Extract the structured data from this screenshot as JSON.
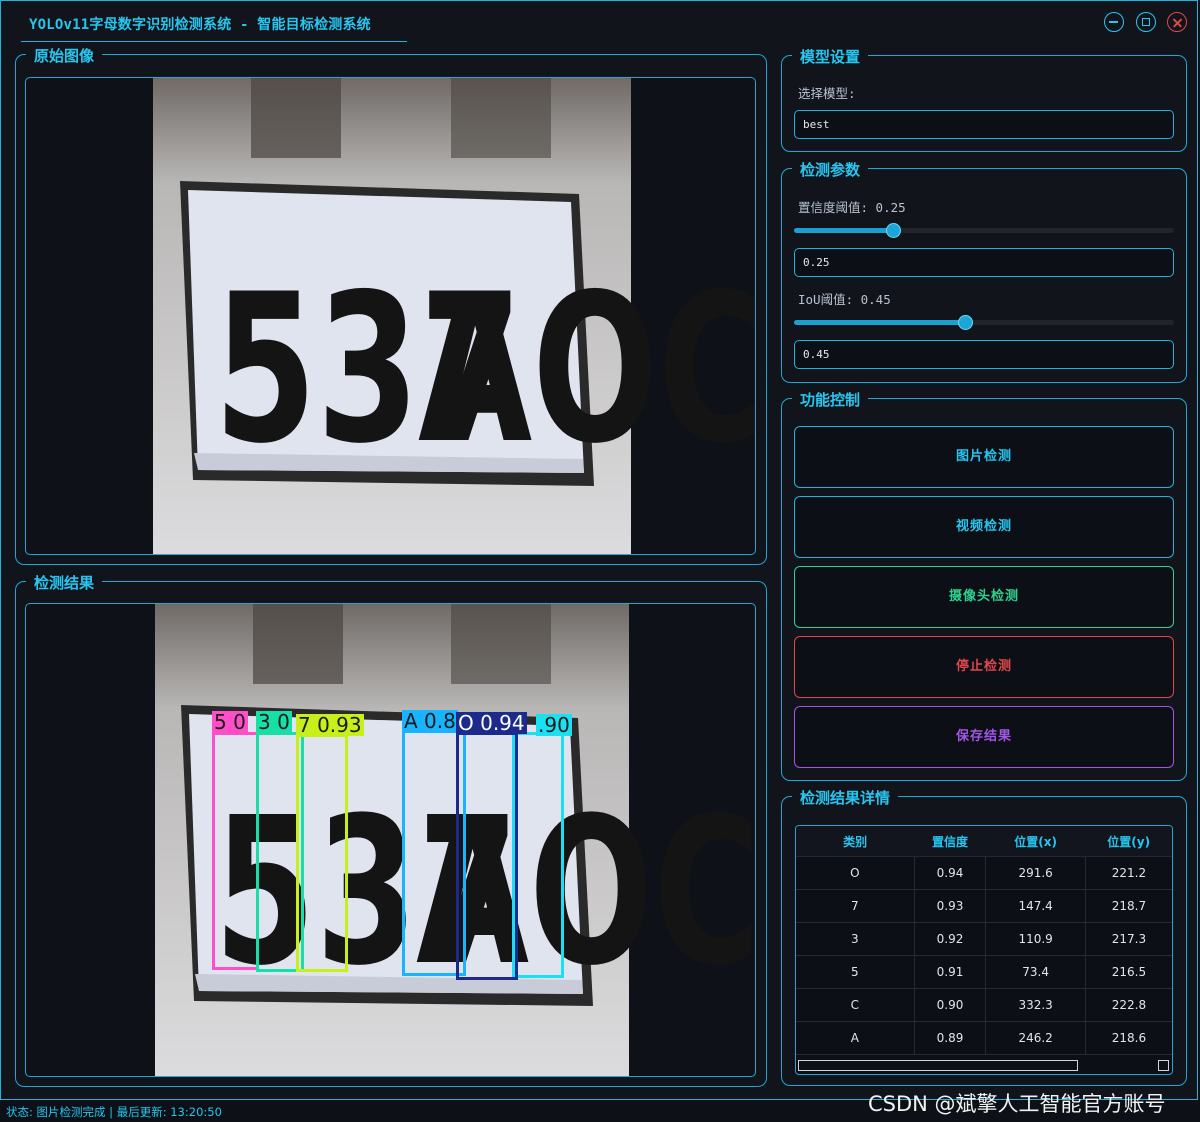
{
  "window": {
    "title": "YOLOv11字母数字识别检测系统 - 智能目标检测系统"
  },
  "panels": {
    "original_title": "原始图像",
    "result_title": "检测结果",
    "model_title": "模型设置",
    "params_title": "检测参数",
    "control_title": "功能控制",
    "details_title": "检测结果详情"
  },
  "plate": {
    "text_left": "537",
    "text_right": "AOC"
  },
  "model": {
    "select_label": "选择模型:",
    "selected": "best"
  },
  "params": {
    "conf_label": "置信度阈值: 0.25",
    "conf_value": "0.25",
    "conf_level": 0.26,
    "iou_label": "IoU阈值: 0.45",
    "iou_value": "0.45",
    "iou_level": 0.45
  },
  "controls": {
    "image_detect": "图片检测",
    "video_detect": "视频检测",
    "camera_detect": "摄像头检测",
    "stop_detect": "停止检测",
    "save_result": "保存结果"
  },
  "detections": [
    {
      "label": "5 0",
      "color": "#ff4fc8"
    },
    {
      "label": "3 0",
      "color": "#16e0a8"
    },
    {
      "label": "7 0.93",
      "color": "#c8ef1a"
    },
    {
      "label": "A 0.8",
      "color": "#18b4ff"
    },
    {
      "label": "O 0.94",
      "color": "#1c2a8c"
    },
    {
      "label": ".90",
      "color": "#1ae0f2"
    }
  ],
  "table": {
    "headers": [
      "类别",
      "置信度",
      "位置(x)",
      "位置(y)"
    ],
    "rows": [
      [
        "O",
        "0.94",
        "291.6",
        "221.2"
      ],
      [
        "7",
        "0.93",
        "147.4",
        "218.7"
      ],
      [
        "3",
        "0.92",
        "110.9",
        "217.3"
      ],
      [
        "5",
        "0.91",
        "73.4",
        "216.5"
      ],
      [
        "C",
        "0.90",
        "332.3",
        "222.8"
      ],
      [
        "A",
        "0.89",
        "246.2",
        "218.6"
      ]
    ]
  },
  "status": {
    "text": "状态: 图片检测完成 | 最后更新: 13:20:50"
  },
  "watermark": "CSDN @斌擎人工智能官方账号",
  "colors": {
    "accent": "#27c6f0",
    "stop": "#e0474c",
    "camera": "#2fd18f",
    "save": "#a355e6",
    "image_btn": "#27c6f0",
    "video_btn": "#27c6f0"
  }
}
